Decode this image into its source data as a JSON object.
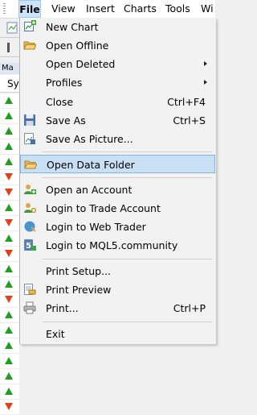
{
  "menubar": {
    "items": [
      "File",
      "View",
      "Insert",
      "Charts",
      "Tools",
      "Wi"
    ]
  },
  "market_watch": {
    "title": "Ma",
    "column_header": "Sy",
    "arrows": [
      "up",
      "up",
      "up",
      "up",
      "up",
      "down",
      "down",
      "up",
      "down",
      "up",
      "down",
      "up",
      "up",
      "down",
      "up",
      "up",
      "up",
      "up",
      "up",
      "up",
      "down"
    ]
  },
  "file_menu": {
    "items": [
      {
        "label": "New Chart",
        "shortcut": "",
        "icon": "new-chart-icon"
      },
      {
        "label": "Open Offline",
        "shortcut": "",
        "icon": "open-folder-icon"
      },
      {
        "label": "Open Deleted",
        "shortcut": "",
        "submenu": true
      },
      {
        "label": "Profiles",
        "shortcut": "",
        "submenu": true
      },
      {
        "label": "Close",
        "shortcut": "Ctrl+F4"
      },
      {
        "label": "Save As",
        "shortcut": "Ctrl+S",
        "icon": "save-disk-icon"
      },
      {
        "label": "Save As Picture...",
        "shortcut": "",
        "icon": "save-picture-icon"
      },
      {
        "label": "Open Data Folder",
        "shortcut": "",
        "icon": "data-folder-icon",
        "highlighted": true
      },
      {
        "label": "Open an Account",
        "shortcut": "",
        "icon": "open-account-icon"
      },
      {
        "label": "Login to Trade Account",
        "shortcut": "",
        "icon": "login-trade-icon"
      },
      {
        "label": "Login to Web Trader",
        "shortcut": "",
        "icon": "web-trader-icon"
      },
      {
        "label": "Login to MQL5.community",
        "shortcut": "",
        "icon": "mql5-community-icon"
      },
      {
        "label": "Print Setup...",
        "shortcut": ""
      },
      {
        "label": "Print Preview",
        "shortcut": "",
        "icon": "print-preview-icon"
      },
      {
        "label": "Print...",
        "shortcut": "Ctrl+P",
        "icon": "printer-icon"
      },
      {
        "label": "Exit",
        "shortcut": ""
      }
    ]
  },
  "colors": {
    "highlight_bg": "#c9dff3",
    "highlight_border": "#7eb4ea",
    "menu_bg": "#f2f2f2",
    "arrow_up": "#1ea01e",
    "arrow_down": "#e0401a"
  }
}
